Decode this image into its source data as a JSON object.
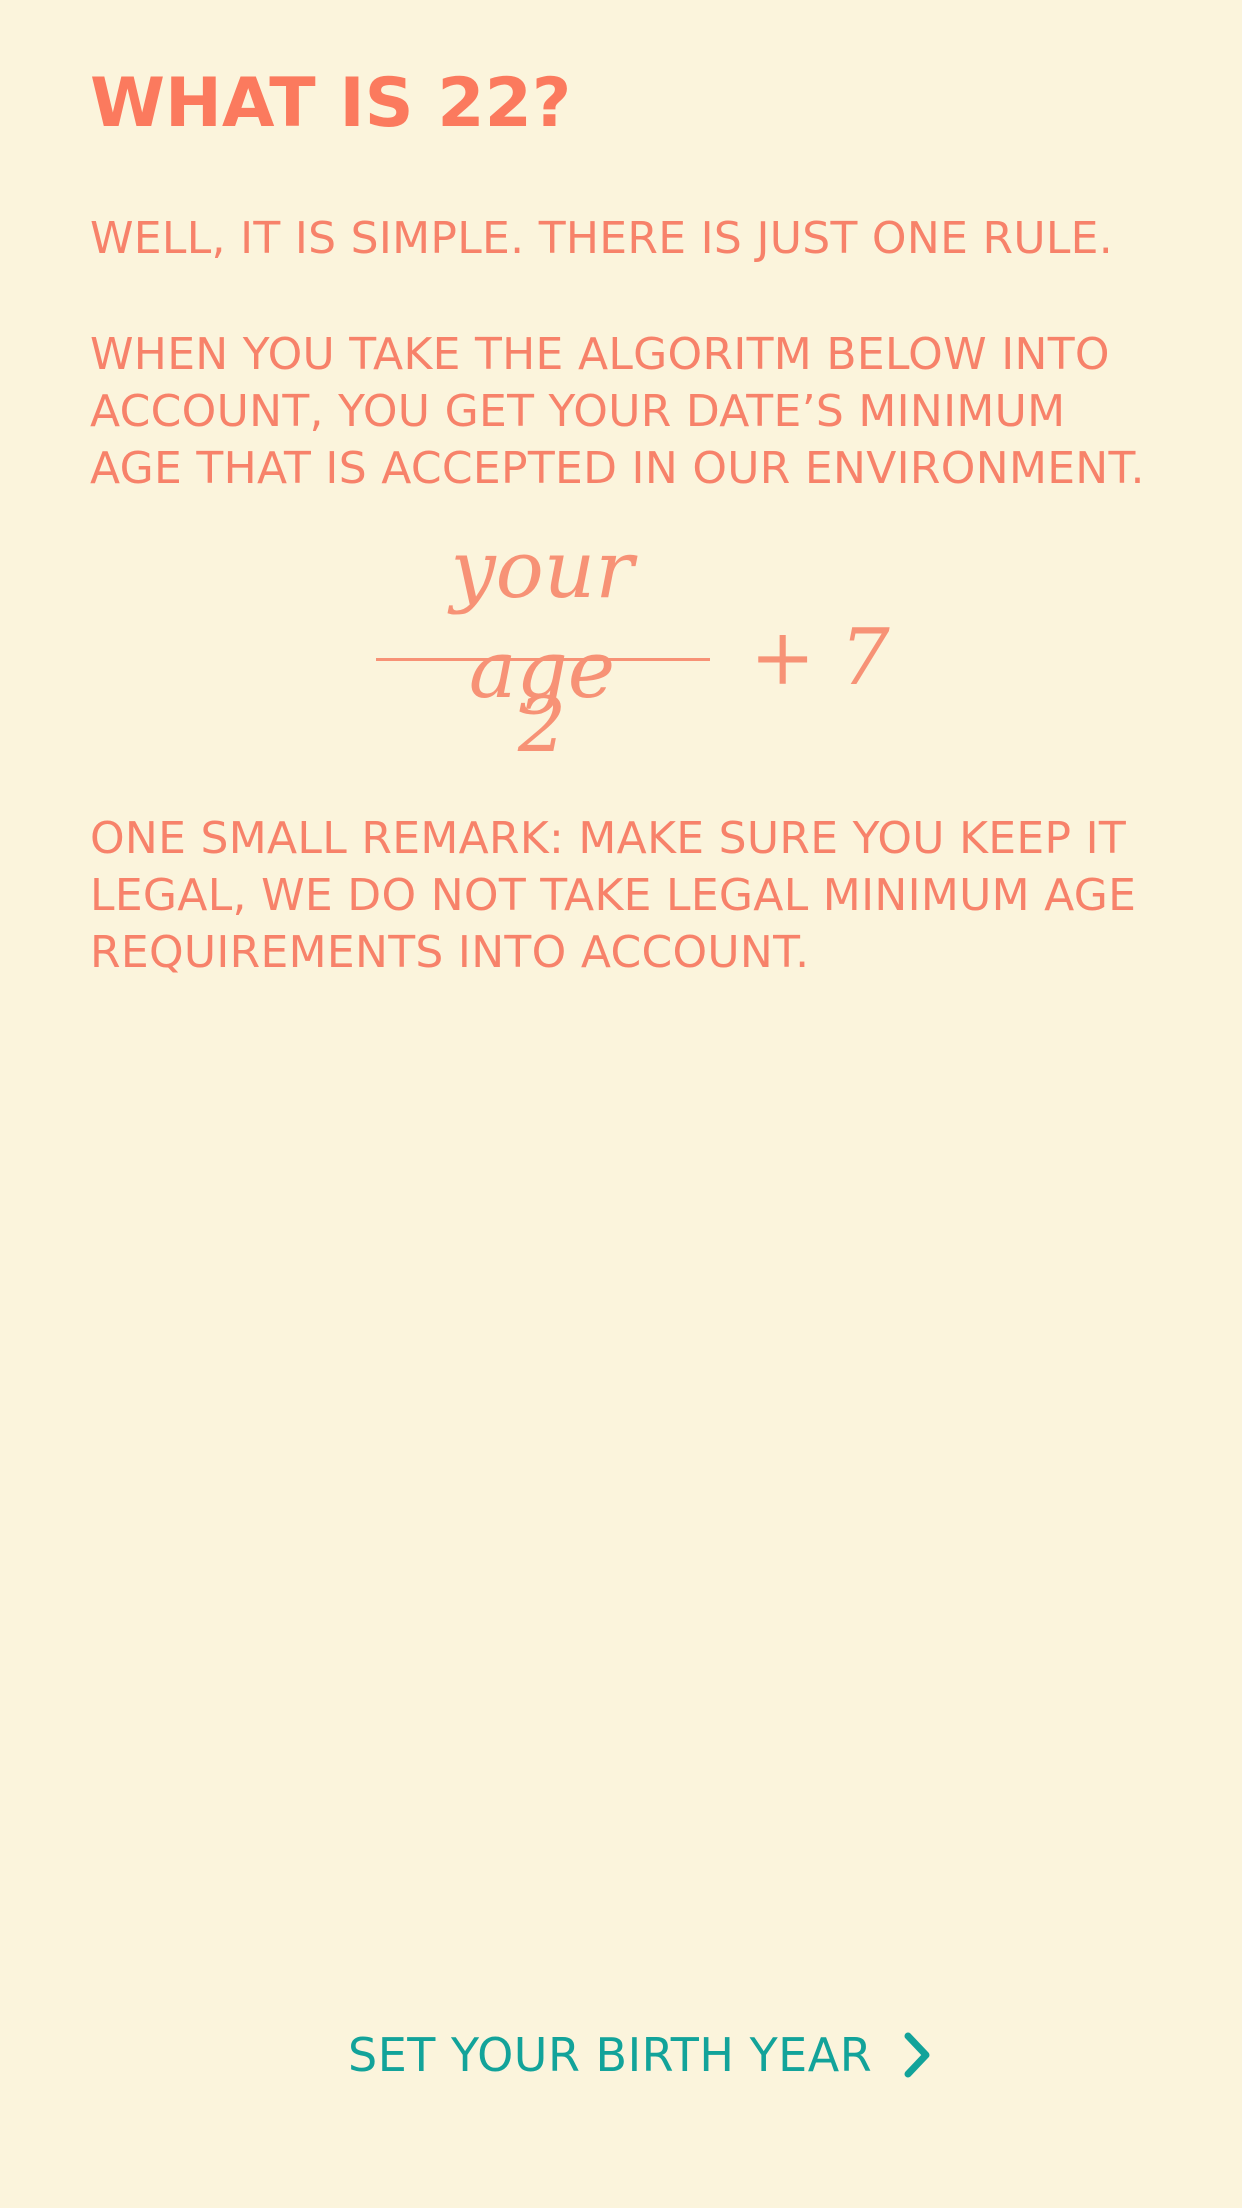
{
  "title": "WHAT IS 22?",
  "paragraphs": {
    "intro": "WELL, IT IS SIMPLE. THERE IS JUST ONE RULE.",
    "explain": "WHEN YOU TAKE THE ALGORITM BELOW INTO ACCOUNT, YOU GET YOUR DATE’S MINIMUM AGE THAT IS ACCEPTED IN OUR ENVIRONMENT.",
    "remark": "ONE SMALL REMARK: MAKE SURE YOU KEEP IT LEGAL, WE DO NOT TAKE LEGAL MINIMUM AGE REQUIREMENTS INTO ACCOUNT."
  },
  "formula": {
    "numerator": "your age",
    "denominator": "2",
    "addend": "+ 7"
  },
  "cta": {
    "label": "SET YOUR BIRTH YEAR",
    "icon": "chevron-right-icon"
  },
  "colors": {
    "background": "#fbf4dc",
    "accent": "#fb7a5e",
    "link": "#12a39a"
  }
}
